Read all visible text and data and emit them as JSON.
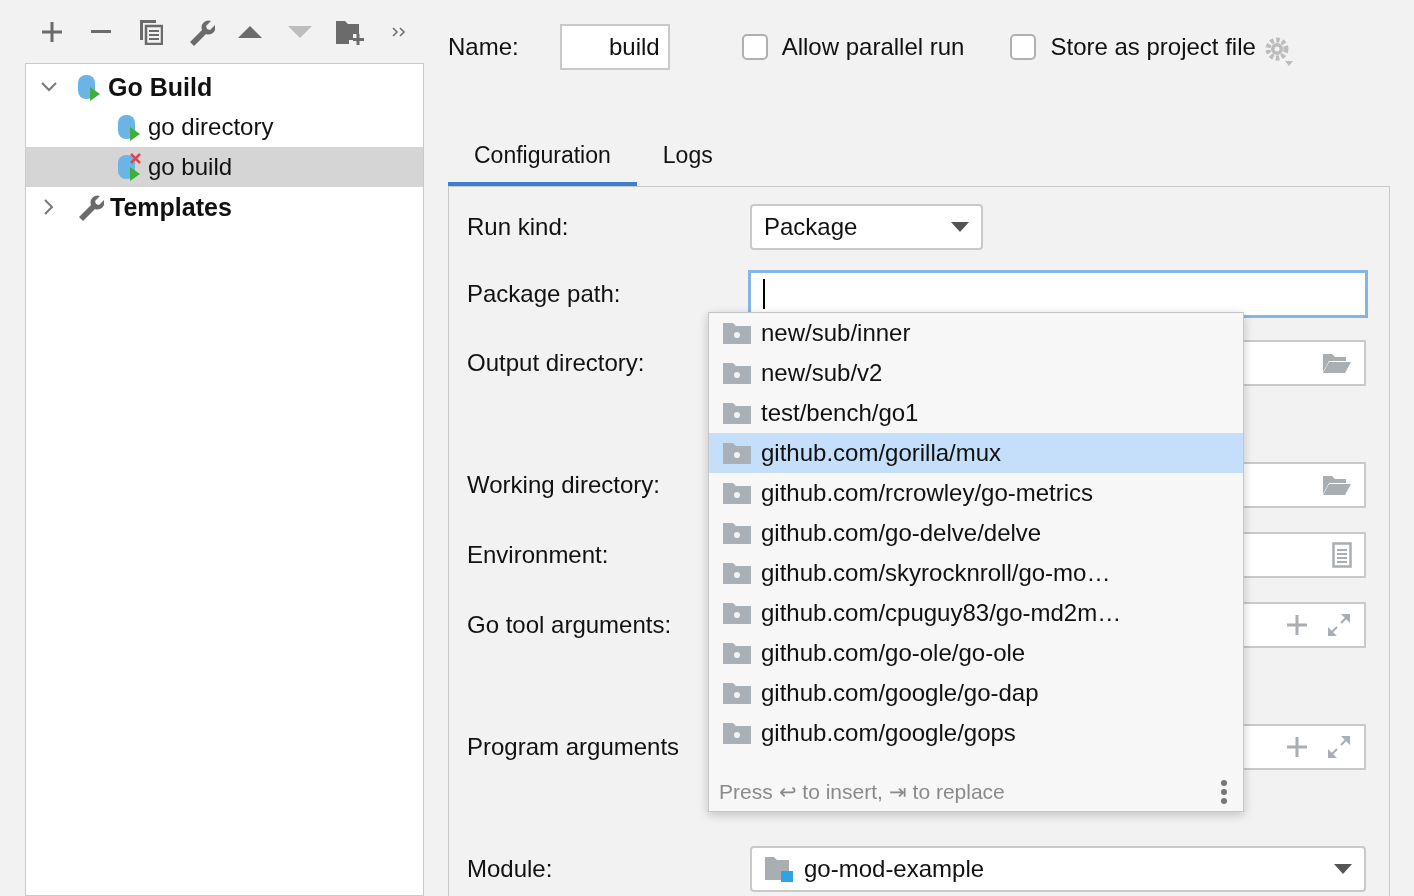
{
  "toolbar": [
    {
      "kind": "add",
      "disabled": false
    },
    {
      "kind": "remove",
      "disabled": false
    },
    {
      "kind": "copy",
      "disabled": false
    },
    {
      "kind": "wrench",
      "disabled": false
    },
    {
      "kind": "up",
      "disabled": false
    },
    {
      "kind": "down",
      "disabled": true
    },
    {
      "kind": "folder-add",
      "disabled": false
    },
    {
      "kind": "more",
      "disabled": false
    }
  ],
  "tree": [
    {
      "label": "Go Build",
      "kind": "config",
      "expanded": true,
      "selected": false,
      "children": [
        {
          "label": "go directory",
          "kind": "config",
          "selected": false,
          "error": false
        },
        {
          "label": "go build",
          "kind": "config",
          "selected": true,
          "error": true
        }
      ]
    },
    {
      "label": "Templates",
      "kind": "wrench",
      "expanded": false,
      "selected": false
    }
  ],
  "name": {
    "label": "Name:",
    "value": "build"
  },
  "checkboxes": [
    {
      "label": "Allow parallel run",
      "checked": false
    },
    {
      "label": "Store as project file",
      "checked": false
    }
  ],
  "tabs": [
    {
      "label": "Configuration",
      "selected": true
    },
    {
      "label": "Logs",
      "selected": false
    }
  ],
  "form": [
    {
      "label": "Run kind:",
      "kind": "dropdown",
      "value": "Package"
    },
    {
      "label": "Package path:",
      "kind": "input",
      "focused": true
    },
    {
      "label": "Output directory:",
      "kind": "folder"
    },
    {
      "label": "Working directory:",
      "kind": "folder"
    },
    {
      "label": "Environment:",
      "kind": "document"
    },
    {
      "label": "Go tool arguments:",
      "kind": "expand"
    },
    {
      "label": "Program arguments",
      "kind": "expand"
    },
    {
      "label": "Module:",
      "kind": "module",
      "value": "go-mod-example"
    }
  ],
  "completion": {
    "items": [
      {
        "label": "new/sub/inner",
        "selected": false
      },
      {
        "label": "new/sub/v2",
        "selected": false
      },
      {
        "label": "test/bench/go1",
        "selected": false
      },
      {
        "label": "github.com/gorilla/mux",
        "selected": true
      },
      {
        "label": "github.com/rcrowley/go-metrics",
        "selected": false
      },
      {
        "label": "github.com/go-delve/delve",
        "selected": false
      },
      {
        "label": "github.com/skyrocknroll/go-mo…",
        "selected": false
      },
      {
        "label": "github.com/cpuguy83/go-md2m…",
        "selected": false
      },
      {
        "label": "github.com/go-ole/go-ole",
        "selected": false
      },
      {
        "label": "github.com/google/go-dap",
        "selected": false
      },
      {
        "label": "github.com/google/gops",
        "selected": false
      }
    ],
    "hint": "Press ↩ to insert, ⇥ to replace"
  }
}
